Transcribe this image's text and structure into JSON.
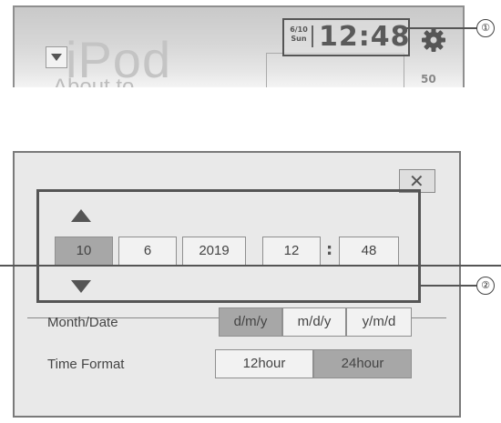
{
  "top_screen": {
    "source_name": "iPod",
    "source_sub": "About to",
    "clock": {
      "date_top": "6/10",
      "date_bottom": "Sun",
      "time": "12:48"
    },
    "side_number": "50"
  },
  "callouts": {
    "one": "①",
    "two": "②"
  },
  "dialog": {
    "close_label": "✕",
    "date_fields": [
      "10",
      "6",
      "2019"
    ],
    "time_fields": [
      "12",
      "48"
    ],
    "time_separator": ":",
    "month_date": {
      "label": "Month/Date",
      "options": [
        "d/m/y",
        "m/d/y",
        "y/m/d"
      ],
      "selected": "d/m/y"
    },
    "time_format": {
      "label": "Time Format",
      "options": [
        "12hour",
        "24hour"
      ],
      "selected": "24hour"
    }
  },
  "icons": {
    "settings": "gear-icon",
    "up": "up-arrow-icon",
    "down": "down-arrow-icon",
    "close": "close-icon",
    "source_menu": "chevron-down-icon"
  },
  "colors": {
    "selected": "#a7a7a7",
    "panel": "#e9e9e9",
    "frame": "#555555"
  }
}
